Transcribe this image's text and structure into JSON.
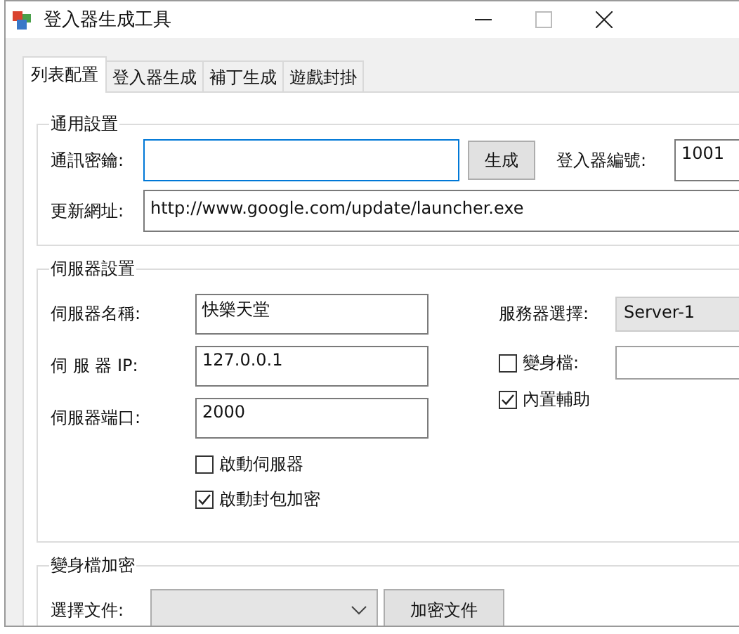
{
  "window": {
    "title": "登入器生成工具"
  },
  "tabs": [
    {
      "label": "列表配置",
      "selected": true
    },
    {
      "label": "登入器生成",
      "selected": false
    },
    {
      "label": "補丁生成",
      "selected": false
    },
    {
      "label": "遊戲封掛",
      "selected": false
    }
  ],
  "general": {
    "title": "通用設置",
    "key": {
      "label": "通訊密鑰:",
      "focused": true
    },
    "generate_button": "生成",
    "launcher_id": {
      "label": "登入器編號:",
      "value": "1001"
    },
    "update_url": {
      "label": "更新網址:",
      "value": "http://www.google.com/update/launcher.exe"
    }
  },
  "server": {
    "title": "伺服器設置",
    "fields": [
      {
        "label": "伺服器名稱:",
        "value": "快樂天堂"
      },
      {
        "label": "伺 服 器 IP:",
        "value": "127.0.0.1"
      },
      {
        "label": "伺服器端口:",
        "value": "2000"
      }
    ],
    "server_select": {
      "label": "服務器選擇:",
      "value": "Server-1"
    },
    "morph_file": {
      "label": "變身檔:",
      "checked": false
    },
    "builtin_assist": {
      "label": "內置輔助",
      "checked": true
    },
    "options": [
      {
        "label": "啟動伺服器",
        "checked": false
      },
      {
        "label": "啟動封包加密",
        "checked": true
      }
    ]
  },
  "encrypt": {
    "title": "變身檔加密",
    "file_label": "選擇文件:",
    "encrypt_button": "加密文件"
  }
}
